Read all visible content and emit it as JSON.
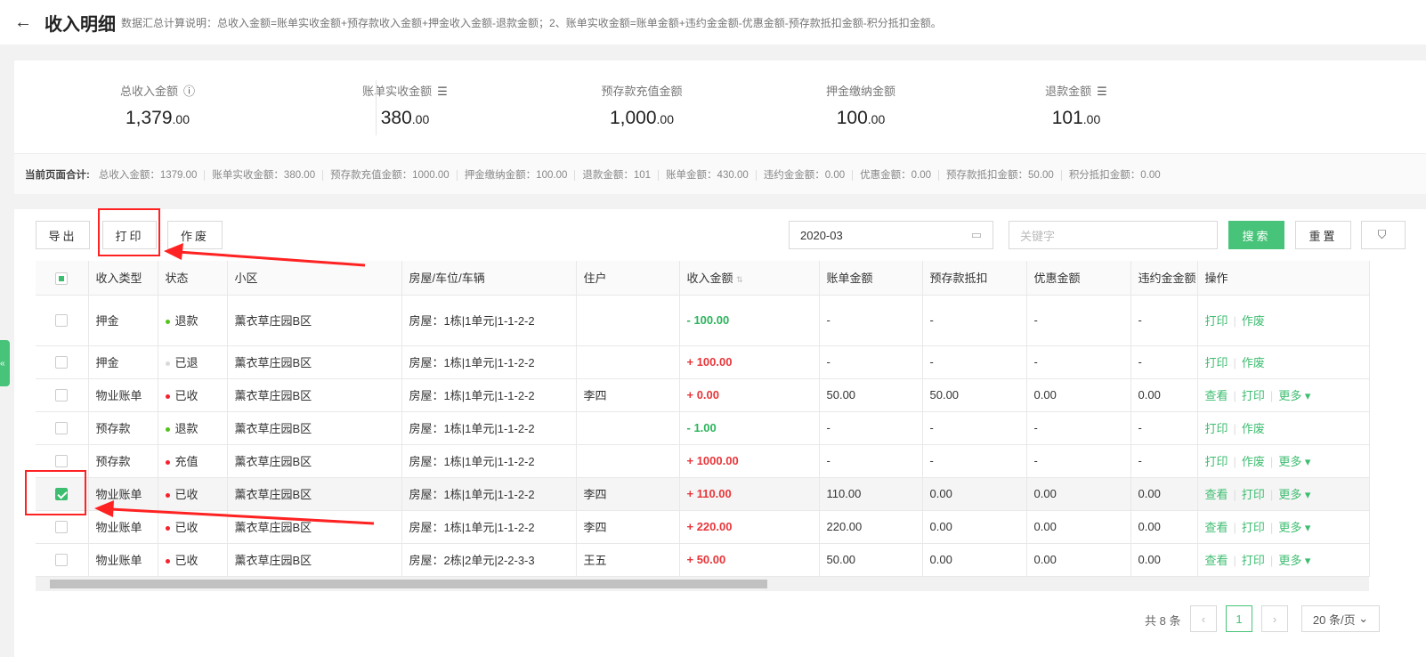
{
  "header": {
    "title": "收入明细",
    "desc": "数据汇总计算说明：总收入金额=账单实收金额+预存款收入金额+押金收入金额-退款金额；2、账单实收金额=账单金额+违约金金额-优惠金额-预存款抵扣金额-积分抵扣金额。"
  },
  "stats": [
    {
      "label": "总收入金额",
      "int": "1,379",
      "dec": ".00",
      "icon": "help-icon"
    },
    {
      "label": "账单实收金额",
      "int": "380",
      "dec": ".00",
      "icon": "list-icon"
    },
    {
      "label": "预存款充值金额",
      "int": "1,000",
      "dec": ".00"
    },
    {
      "label": "押金缴纳金额",
      "int": "100",
      "dec": ".00"
    },
    {
      "label": "退款金额",
      "int": "101",
      "dec": ".00",
      "icon": "list-icon"
    }
  ],
  "summary": {
    "title": "当前页面合计:",
    "items": [
      "总收入金额：1379.00",
      "账单实收金额：380.00",
      "预存款充值金额：1000.00",
      "押金缴纳金额：100.00",
      "退款金额：101",
      "账单金额：430.00",
      "违约金金额：0.00",
      "优惠金额：0.00",
      "预存款抵扣金额：50.00",
      "积分抵扣金额：0.00"
    ]
  },
  "toolbar": {
    "export": "导出",
    "print": "打印",
    "void": "作废",
    "date": "2020-03",
    "keyword_placeholder": "关键字",
    "search": "搜索",
    "reset": "重置"
  },
  "table": {
    "headers": [
      "收入类型",
      "状态",
      "小区",
      "房屋/车位/车辆",
      "住户",
      "收入金额",
      "账单金额",
      "预存款抵扣",
      "优惠金额",
      "违约金金额",
      "操作"
    ],
    "rows": [
      {
        "type": "押金",
        "status": "退款",
        "dot": "#52c41a",
        "area": "薰衣草庄园B区",
        "house": "房屋：1栋|1单元|1-1-2-2",
        "owner": "",
        "amount": "- 100.00",
        "sign": "neg",
        "bill": "-",
        "pre": "-",
        "disc": "-",
        "late": "-",
        "ops": [
          "打印",
          "作废"
        ],
        "checked": false
      },
      {
        "type": "押金",
        "status": "已退",
        "dot": "#d9d9d9",
        "area": "薰衣草庄园B区",
        "house": "房屋：1栋|1单元|1-1-2-2",
        "owner": "",
        "amount": "+ 100.00",
        "sign": "pos",
        "bill": "-",
        "pre": "-",
        "disc": "-",
        "late": "-",
        "ops": [
          "打印",
          "作废"
        ],
        "checked": false
      },
      {
        "type": "物业账单",
        "status": "已收",
        "dot": "#f5222d",
        "area": "薰衣草庄园B区",
        "house": "房屋：1栋|1单元|1-1-2-2",
        "owner": "李四",
        "amount": "+ 0.00",
        "sign": "pos",
        "bill": "50.00",
        "pre": "50.00",
        "disc": "0.00",
        "late": "0.00",
        "ops": [
          "查看",
          "打印",
          "更多 ▾"
        ],
        "checked": false
      },
      {
        "type": "预存款",
        "status": "退款",
        "dot": "#52c41a",
        "area": "薰衣草庄园B区",
        "house": "房屋：1栋|1单元|1-1-2-2",
        "owner": "",
        "amount": "- 1.00",
        "sign": "neg",
        "bill": "-",
        "pre": "-",
        "disc": "-",
        "late": "-",
        "ops": [
          "打印",
          "作废"
        ],
        "checked": false
      },
      {
        "type": "预存款",
        "status": "充值",
        "dot": "#f5222d",
        "area": "薰衣草庄园B区",
        "house": "房屋：1栋|1单元|1-1-2-2",
        "owner": "",
        "amount": "+ 1000.00",
        "sign": "pos",
        "bill": "-",
        "pre": "-",
        "disc": "-",
        "late": "-",
        "ops": [
          "打印",
          "作废",
          "更多 ▾"
        ],
        "checked": false
      },
      {
        "type": "物业账单",
        "status": "已收",
        "dot": "#f5222d",
        "area": "薰衣草庄园B区",
        "house": "房屋：1栋|1单元|1-1-2-2",
        "owner": "李四",
        "amount": "+ 110.00",
        "sign": "pos",
        "bill": "110.00",
        "pre": "0.00",
        "disc": "0.00",
        "late": "0.00",
        "ops": [
          "查看",
          "打印",
          "更多 ▾"
        ],
        "checked": true
      },
      {
        "type": "物业账单",
        "status": "已收",
        "dot": "#f5222d",
        "area": "薰衣草庄园B区",
        "house": "房屋：1栋|1单元|1-1-2-2",
        "owner": "李四",
        "amount": "+ 220.00",
        "sign": "pos",
        "bill": "220.00",
        "pre": "0.00",
        "disc": "0.00",
        "late": "0.00",
        "ops": [
          "查看",
          "打印",
          "更多 ▾"
        ],
        "checked": false
      },
      {
        "type": "物业账单",
        "status": "已收",
        "dot": "#f5222d",
        "area": "薰衣草庄园B区",
        "house": "房屋：2栋|2单元|2-2-3-3",
        "owner": "王五",
        "amount": "+ 50.00",
        "sign": "pos",
        "bill": "50.00",
        "pre": "0.00",
        "disc": "0.00",
        "late": "0.00",
        "ops": [
          "查看",
          "打印",
          "更多 ▾"
        ],
        "checked": false
      }
    ]
  },
  "pagination": {
    "total": "共 8 条",
    "current": "1",
    "page_size": "20 条/页"
  }
}
